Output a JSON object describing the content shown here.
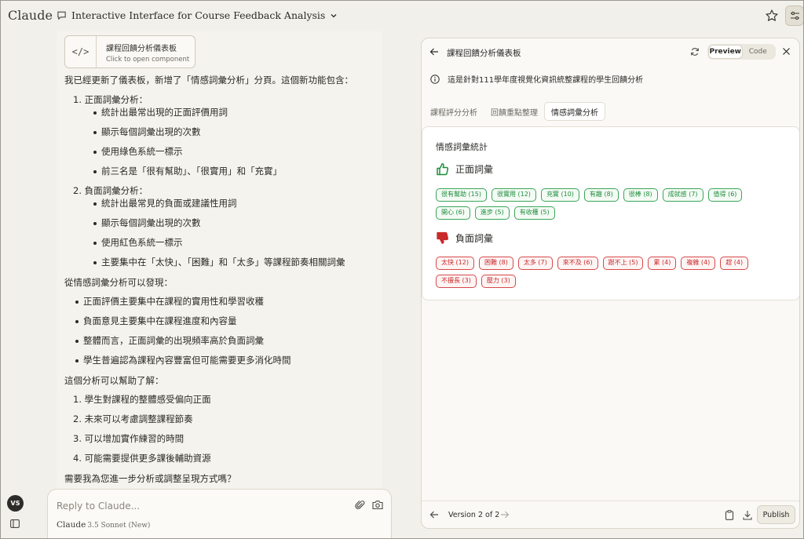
{
  "app": {
    "brand": "Claude",
    "conversation_title": "Interactive Interface for Course Feedback Analysis"
  },
  "artifact_card": {
    "title": "課程回饋分析儀表板",
    "subtitle": "Click to open component"
  },
  "message": {
    "intro": "我已經更新了儀表板，新增了「情感詞彙分析」分頁。這個新功能包含：",
    "sections": [
      {
        "num": "1.",
        "title": "正面詞彙分析：",
        "bullets": [
          "統計出最常出現的正面評價用詞",
          "顯示每個詞彙出現的次數",
          "使用綠色系統一標示",
          "前三名是「很有幫助」、「很實用」和「充實」"
        ]
      },
      {
        "num": "2.",
        "title": "負面詞彙分析：",
        "bullets": [
          "統計出最常見的負面或建議性用詞",
          "顯示每個詞彙出現的次數",
          "使用紅色系統一標示",
          "主要集中在「太快」、「困難」和「太多」等課程節奏相關詞彙"
        ]
      }
    ],
    "findings_title": "從情感詞彙分析可以發現：",
    "findings": [
      "正面評價主要集中在課程的實用性和學習收穫",
      "負面意見主要集中在課程進度和內容量",
      "整體而言，正面詞彙的出現頻率高於負面詞彙",
      "學生普遍認為課程內容豐富但可能需要更多消化時間"
    ],
    "help_title": "這個分析可以幫助了解：",
    "help_items": [
      "1. 學生對課程的整體感受偏向正面",
      "2. 未來可以考慮調整課程節奏",
      "3. 可以增加實作練習的時間",
      "4. 可能需要提供更多課後輔助資源"
    ],
    "closing": "需要我為您進一步分析或調整呈現方式嗎？"
  },
  "user": {
    "initials": "VS"
  },
  "composer": {
    "placeholder": "Reply to Claude...",
    "model": "Claude",
    "model_version": "3.5 Sonnet (New)"
  },
  "panel": {
    "title": "課程回饋分析儀表板",
    "preview_label": "Preview",
    "code_label": "Code",
    "info": "這是針對111學年度視覺化資訊統整課程的學生回饋分析",
    "tabs": [
      "課程評分分析",
      "回饋重點整理",
      "情感詞彙分析"
    ],
    "active_tab": 2,
    "card_title": "情感詞彙統計",
    "positive_title": "正面詞彙",
    "negative_title": "負面詞彙",
    "positive_tags": [
      "很有幫助 (15)",
      "很實用 (12)",
      "充實 (10)",
      "有趣 (8)",
      "很棒 (8)",
      "成就感 (7)",
      "值得 (6)",
      "開心 (6)",
      "進步 (5)",
      "有收穫 (5)"
    ],
    "negative_tags": [
      "太快 (12)",
      "困難 (8)",
      "太多 (7)",
      "來不及 (6)",
      "跟不上 (5)",
      "累 (4)",
      "複雜 (4)",
      "趕 (4)",
      "不擅長 (3)",
      "壓力 (3)"
    ],
    "version": "Version 2 of 2",
    "publish_label": "Publish"
  },
  "colors": {
    "positive": "#1e8c3a",
    "negative": "#c92a2a",
    "background": "#f2f0ea"
  }
}
